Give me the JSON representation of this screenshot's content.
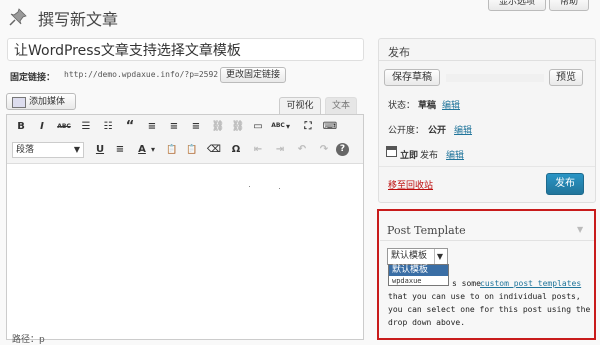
{
  "header": {
    "title": "撰写新文章",
    "screen_options": "显示选项",
    "help": "帮助"
  },
  "post": {
    "title_value": "让WordPress文章支持选择文章模板",
    "permalink_label": "固定链接：",
    "permalink_url": "http://demo.wpdaxue.info/?p=2592",
    "change_permalink": "更改固定链接"
  },
  "editor": {
    "add_media": "添加媒体",
    "tab_visual": "可视化",
    "tab_text": "文本",
    "toolbar_row1": [
      "B",
      "I",
      "ABC",
      "☰",
      "☷",
      "“",
      "≡",
      "≡",
      "≡",
      "⛓",
      "⛓",
      "▭",
      "ABC",
      "▾",
      "⛶",
      "⌨"
    ],
    "toolbar_row2": [
      "U",
      "≡",
      "A",
      "▾",
      "📋",
      "📋",
      "⌫",
      "Ω",
      "⇤",
      "⇥",
      "↶",
      "↷",
      "?"
    ],
    "format_select": "段落",
    "path_label": "路径：p"
  },
  "publish": {
    "title": "发布",
    "save_draft": "保存草稿",
    "preview": "预览",
    "status_label": "状态：",
    "status_value": "草稿",
    "status_edit": "编辑",
    "visibility_label": "公开度：",
    "visibility_value": "公开",
    "visibility_edit": "编辑",
    "schedule_now": "立即",
    "schedule_label": "发布",
    "schedule_edit": "编辑",
    "trash": "移至回收站",
    "publish_button": "发布"
  },
  "post_template": {
    "title": "Post Template",
    "selected": "默认模板",
    "options": [
      "默认模板",
      "wpdaxue"
    ],
    "desc_line1_prefix": "s some ",
    "desc_link": "custom post templates",
    "desc_line2": "that you can use to on individual posts,",
    "desc_line3": "you can select one for this post using the",
    "desc_line4": "drop down above.",
    "highlight_color": "#c81b1b"
  },
  "colors": {
    "link": "#21759b",
    "primary_button": "#21759b",
    "trash": "#bc0b0b"
  },
  "icons": {
    "header": "pushpin-icon",
    "media": "media-icon",
    "schedule": "calendar-icon"
  }
}
